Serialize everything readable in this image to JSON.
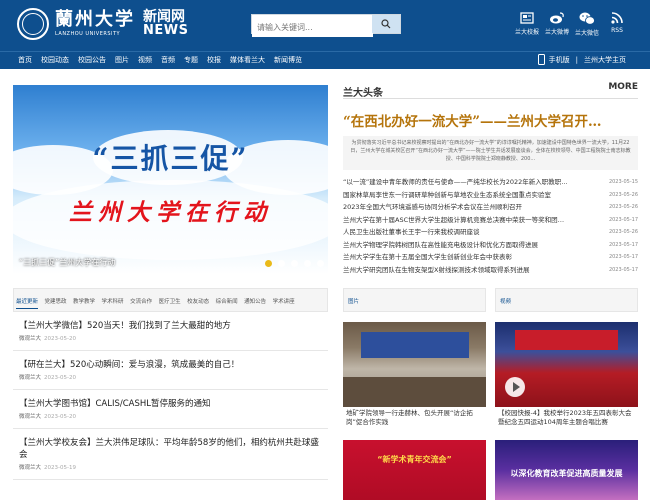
{
  "header": {
    "logo_cn": "蘭州大学",
    "logo_en": "LANZHOU UNIVERSITY",
    "news_cn": "新闻网",
    "news_en": "NEWS",
    "search_placeholder": "请输入关键词...",
    "icons": [
      {
        "label": "兰大校报",
        "icon": "newspaper-icon"
      },
      {
        "label": "兰大微博",
        "icon": "weibo-icon"
      },
      {
        "label": "兰大微信",
        "icon": "wechat-icon"
      },
      {
        "label": "RSS",
        "icon": "rss-icon"
      }
    ]
  },
  "nav": {
    "items": [
      "首页",
      "校园动态",
      "校园公告",
      "图片",
      "视频",
      "音频",
      "专题",
      "校报",
      "媒体看兰大",
      "新闻博览"
    ],
    "mobile": "手机版",
    "home": "兰州大学主页"
  },
  "banner": {
    "title1": "“三抓三促”",
    "title2": "兰州大学在行动",
    "caption": "“三抓三促”兰州大学在行动",
    "dots": 5,
    "active_dot": 0
  },
  "headlines": {
    "title": "兰大头条",
    "more": "MORE",
    "main": "“在西北办好一流大学”——兰州大学召开…",
    "summary": "为贯彻落实习近平总书记来校视察时提出的“在西北办好一流大学”的谆谆嘱托精神，加速建设中国特色世界一流大学，11月22日，兰州大学在城关校区召开“在西北办好一流大学”——院士学生共话发展座谈会，全体在校校领导、中国工程院院士南志标教授、中国科学院院士郑晓静教授、200...",
    "items": [
      {
        "title": "“以一流”建设中青年教师的责任与使命——严纯华校长为2022年新入职教职…",
        "date": "2023-05-15"
      },
      {
        "title": "国家林草局李世东一行调研草种创新与草地农业生态系统全国重点实验室",
        "date": "2023-05-26"
      },
      {
        "title": "2023年全国大气环境遥感与协同分析学术会议在兰州顺利召开",
        "date": "2023-05-26"
      },
      {
        "title": "兰州大学在第十届ASC世界大学生超级计算机竞赛总决赛中荣获一等奖和团…",
        "date": "2023-05-17"
      },
      {
        "title": "人民卫生出版社董事长王宇一行来我校调研座谈",
        "date": "2023-05-26"
      },
      {
        "title": "兰州大学物理学院韩树团队在高性能充电极设计和优化方面取得进展",
        "date": "2023-05-17"
      },
      {
        "title": "兰州大学学生在第十五届全国大学生创新创业年会中获表彰",
        "date": "2023-05-17"
      },
      {
        "title": "兰州大学研究团队在生物支架型X射线探测技术领域取得系列进展",
        "date": "2023-05-17"
      }
    ]
  },
  "tabs": {
    "items": [
      "最近更新",
      "党建思政",
      "教学教学",
      "学术科研",
      "交流合作",
      "医疗卫生",
      "校友动态",
      "综合新闻",
      "通知公告",
      "学术讲座"
    ],
    "active": 0
  },
  "articles": [
    {
      "title": "【兰州大学微信】520当天！我们找到了兰大最甜的地方",
      "source": "微观兰大",
      "date": "2023-05-20"
    },
    {
      "title": "【研在兰大】520心动瞬间：爱与浪漫，筑成最美的自己！",
      "source": "微观兰大",
      "date": "2023-05-20"
    },
    {
      "title": "【兰州大学图书馆】CALIS/CASHL暂停服务的通知",
      "source": "微观兰大",
      "date": "2023-05-20"
    },
    {
      "title": "【兰州大学校友会】兰大洪伟足球队：平均年龄58岁的他们，相约杭州共赴球盛会",
      "source": "微观兰大",
      "date": "2023-05-19"
    }
  ],
  "columns": {
    "pictures_label": "图片",
    "video_label": "视频"
  },
  "cards": {
    "pic1_caption": "地矿学院领导一行走赫林、包头开展“访企拓岗”促合作实践",
    "vid1_caption": "【校园快报-4】我校举行2023年五四表彰大会暨纪念五四运动104周年主题合唱比赛",
    "pic2_banner": "“新学术青年交流会”",
    "vid2_banner": "以深化教育改革促进高质量发展"
  },
  "colors": {
    "brand_blue": "#0e4f8e",
    "headline_gold": "#b5740b",
    "banner_red": "#e3141c",
    "banner_blue": "#1555a5"
  }
}
